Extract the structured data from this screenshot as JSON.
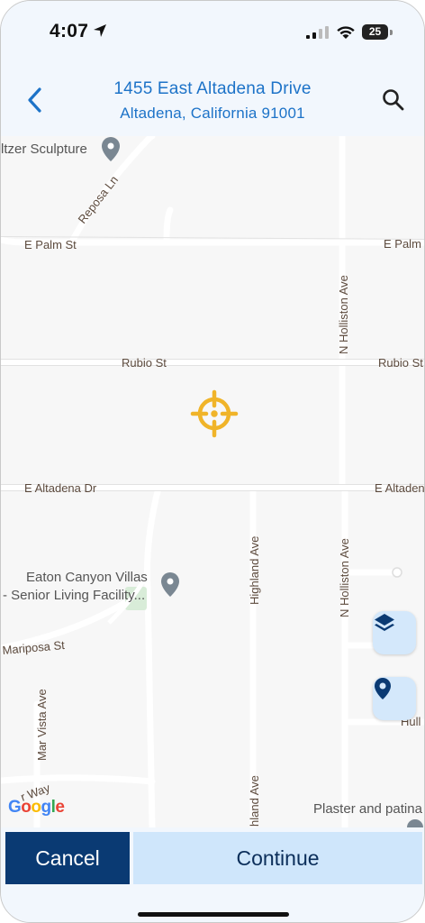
{
  "status_bar": {
    "time": "4:07",
    "battery": "25"
  },
  "header": {
    "address_line1": "1455 East Altadena Drive",
    "address_line2": "Altadena, California 91001",
    "back_icon": "chevron-left-icon",
    "search_icon": "search-icon"
  },
  "map": {
    "streets": {
      "palm_left": "E Palm St",
      "palm_right": "E Palm",
      "reposa": "Reposa Ln",
      "rubio_left": "Rubio St",
      "rubio_right": "Rubio St",
      "holliston_top": "N Holliston Ave",
      "holliston_bottom": "N Holliston Ave",
      "altadena_left": "E Altadena Dr",
      "altadena_right": "E Altadena",
      "highland_top": "Highland Ave",
      "highland_bottom": "hland Ave",
      "mariposa": "Mariposa St",
      "mar_vista": "Mar Vista Ave",
      "way": "r Way",
      "hull": "Hull"
    },
    "pois": {
      "sculpture": "ltzer Sculpture",
      "eaton_line1": "Eaton Canyon Villas",
      "eaton_line2": "- Senior Living Facility...",
      "plaster": "Plaster and patina"
    },
    "attribution": "Google",
    "layers_icon": "layers-icon",
    "pin_icon": "map-pin-icon",
    "crosshair_icon": "crosshair-icon",
    "colors": {
      "crosshair": "#f0b429",
      "accent": "#1d73c8",
      "fab_bg": "#d4e8fb"
    }
  },
  "footer": {
    "cancel_label": "Cancel",
    "continue_label": "Continue"
  }
}
